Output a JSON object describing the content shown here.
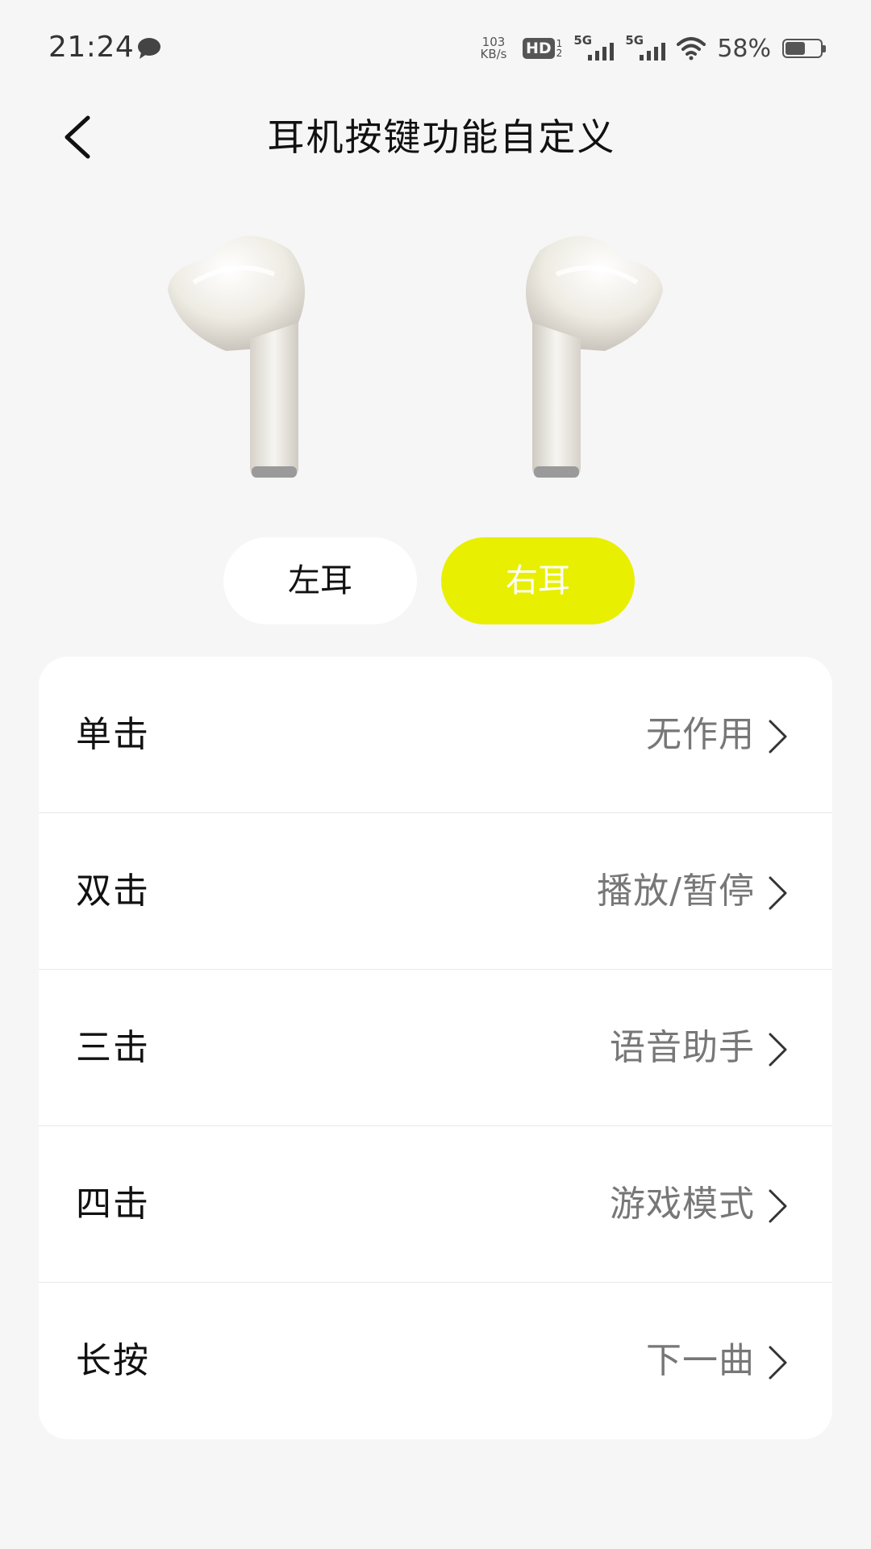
{
  "status_bar": {
    "time": "21:24",
    "net_speed_value": "103",
    "net_speed_unit": "KB/s",
    "hd_label": "HD",
    "hd_sub_top": "1",
    "hd_sub_bottom": "2",
    "signal1_label": "5G",
    "signal2_label": "5G",
    "battery_percent": "58%",
    "battery_level": 0.58
  },
  "header": {
    "title": "耳机按键功能自定义"
  },
  "ear_switch": {
    "left_label": "左耳",
    "right_label": "右耳",
    "selected": "right",
    "accent_color": "#e8ef00"
  },
  "settings": [
    {
      "label": "单击",
      "value": "无作用"
    },
    {
      "label": "双击",
      "value": "播放/暂停"
    },
    {
      "label": "三击",
      "value": "语音助手"
    },
    {
      "label": "四击",
      "value": "游戏模式"
    },
    {
      "label": "长按",
      "value": "下一曲"
    }
  ]
}
